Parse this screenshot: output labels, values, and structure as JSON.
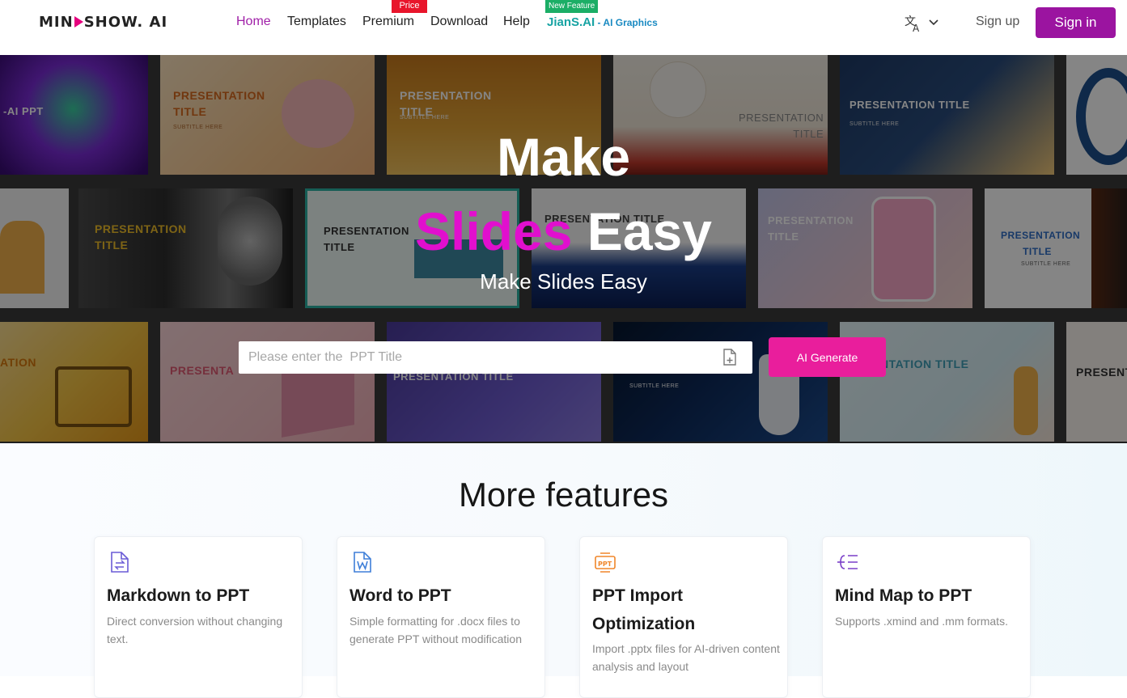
{
  "header": {
    "logo_left": "MIN",
    "logo_right": "SHOW. AI",
    "nav": [
      "Home",
      "Templates",
      "Premium",
      "Download",
      "Help"
    ],
    "price_badge": "Price",
    "new_feature_badge": "New Feature",
    "jians_label": "JianS.AI",
    "jians_sub": " - AI Graphics",
    "sign_up": "Sign up",
    "sign_in": "Sign in"
  },
  "hero": {
    "line1": "Make",
    "line2_pink": "Slides",
    "line2_white": " Easy",
    "subtitle": "Make Slides Easy",
    "search_placeholder": "Please enter the  PPT Title",
    "generate_button": "AI Generate",
    "thumbnails": {
      "title_short": "PRESENTATION TITLE",
      "title_line1": "PRESENTATION",
      "title_line2": "TITLE",
      "subtitle": "SUBTITLE HERE",
      "ai_ppt": "-AI PPT",
      "partial_presen": "PRESEN",
      "partial_ation": "ATION",
      "partial_ntation_title": "NTATION TITLE",
      "partial_presenta": "PRESENTA",
      "partial_presentation_title": "PRESENTATION TITLE",
      "partial_present": "PRESENT",
      "partial_title": "TITLE",
      "partial_subtitle": "SUBTITLE HERE"
    }
  },
  "features": {
    "title": "More features",
    "cards": [
      {
        "title": "Markdown to PPT",
        "desc": "Direct conversion without changing text.",
        "icon": "markdown-file-icon"
      },
      {
        "title": "Word to PPT",
        "desc": "Simple formatting for .docx files to generate PPT without modification",
        "icon": "word-file-icon"
      },
      {
        "title": "PPT Import Optimization",
        "desc": "Import .pptx files for AI-driven content analysis and layout",
        "icon": "ppt-file-icon"
      },
      {
        "title": "Mind Map to PPT",
        "desc": "Supports .xmind and .mm formats.",
        "icon": "mind-map-icon"
      }
    ]
  },
  "colors": {
    "brand_purple": "#9b14a0",
    "accent_pink": "#e91e9c",
    "hero_pink_text": "#e10fce",
    "nav_active": "#a020a8"
  }
}
